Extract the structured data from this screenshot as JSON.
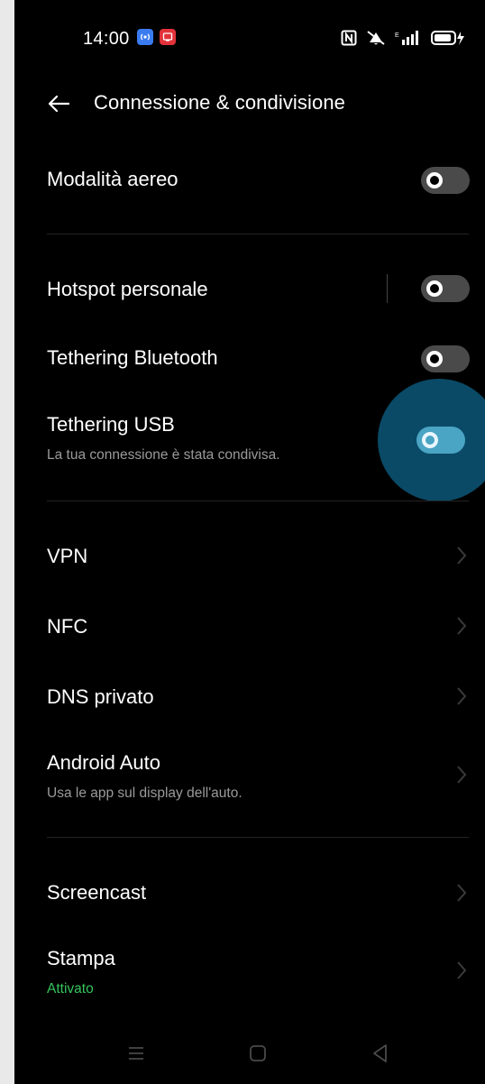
{
  "status_bar": {
    "time": "14:00",
    "notif_icons": [
      "hotspot-icon",
      "cast-icon"
    ],
    "right_icons": [
      "nfc-icon",
      "mute-icon",
      "signal-icon",
      "battery-icon"
    ]
  },
  "header": {
    "title": "Connessione & condivisione"
  },
  "settings": {
    "airplane": {
      "label": "Modalità aereo",
      "enabled": false
    },
    "hotspot": {
      "label": "Hotspot personale",
      "enabled": false
    },
    "bt_tether": {
      "label": "Tethering Bluetooth",
      "enabled": false
    },
    "usb_tether": {
      "label": "Tethering USB",
      "subtitle": "La tua connessione è stata condivisa.",
      "enabled": true
    },
    "vpn": {
      "label": "VPN"
    },
    "nfc": {
      "label": "NFC"
    },
    "dns": {
      "label": "DNS privato"
    },
    "android_auto": {
      "label": "Android Auto",
      "subtitle": "Usa le app sul display dell'auto."
    },
    "screencast": {
      "label": "Screencast"
    },
    "print": {
      "label": "Stampa",
      "subtitle": "Attivato"
    }
  },
  "colors": {
    "background": "#000000",
    "accent": "#4aa4c4",
    "ripple": "#0a4a66",
    "status_green": "#36c45c",
    "toggle_off": "#4a4a4a"
  },
  "nav_bar": {
    "icons": [
      "menu-icon",
      "home-icon",
      "back-icon"
    ]
  }
}
